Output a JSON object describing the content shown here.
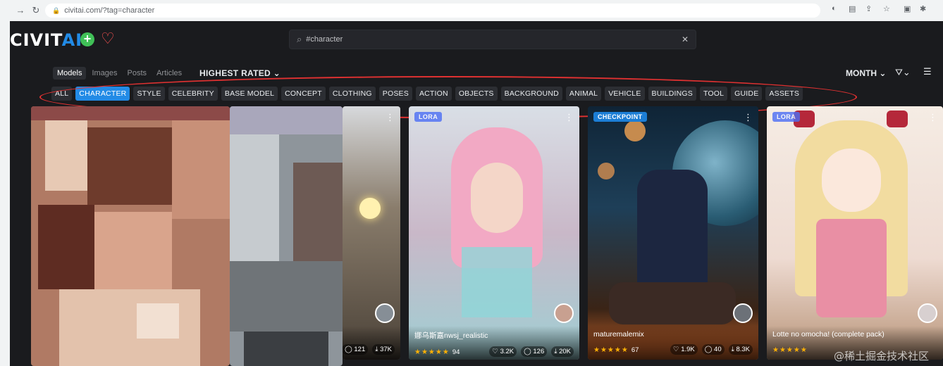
{
  "browser": {
    "url": "civitai.com/?tag=character"
  },
  "brand": {
    "logo_main": "CIVIT",
    "logo_accent": "AI"
  },
  "search": {
    "query": "#character"
  },
  "tabs": [
    {
      "label": "Models",
      "active": true
    },
    {
      "label": "Images",
      "active": false
    },
    {
      "label": "Posts",
      "active": false
    },
    {
      "label": "Articles",
      "active": false
    }
  ],
  "sort_label": "HIGHEST RATED",
  "period_label": "MONTH",
  "tags": [
    "ALL",
    "CHARACTER",
    "STYLE",
    "CELEBRITY",
    "BASE MODEL",
    "CONCEPT",
    "CLOTHING",
    "POSES",
    "ACTION",
    "OBJECTS",
    "BACKGROUND",
    "ANIMAL",
    "VEHICLE",
    "BUILDINGS",
    "TOOL",
    "GUIDE",
    "ASSETS"
  ],
  "active_tag": "CHARACTER",
  "cards": [
    {
      "badge": "LORA",
      "name": "娜乌斯嘉nwsj_realistic",
      "stars": "★★★★★",
      "rating_count": "94",
      "likes": "3.2K",
      "comments": "126",
      "downloads": "20K"
    },
    {
      "badge": "CHECKPOINT",
      "name": "maturemalemix",
      "stars": "★★★★★",
      "rating_count": "67",
      "likes": "1.9K",
      "comments": "40",
      "downloads": "8.3K"
    },
    {
      "badge": "LORA",
      "name": "Lotte no omocha! (complete pack)",
      "stars": "★★★★★",
      "rating_count": "",
      "likes": "",
      "comments": "",
      "downloads": ""
    }
  ],
  "partial_card": {
    "comments": "121",
    "downloads": "37K"
  },
  "watermark": "@稀土掘金技术社区",
  "colors": {
    "app_bg": "#1a1b1e",
    "accent": "#228be6",
    "highlight": "#e03131"
  }
}
